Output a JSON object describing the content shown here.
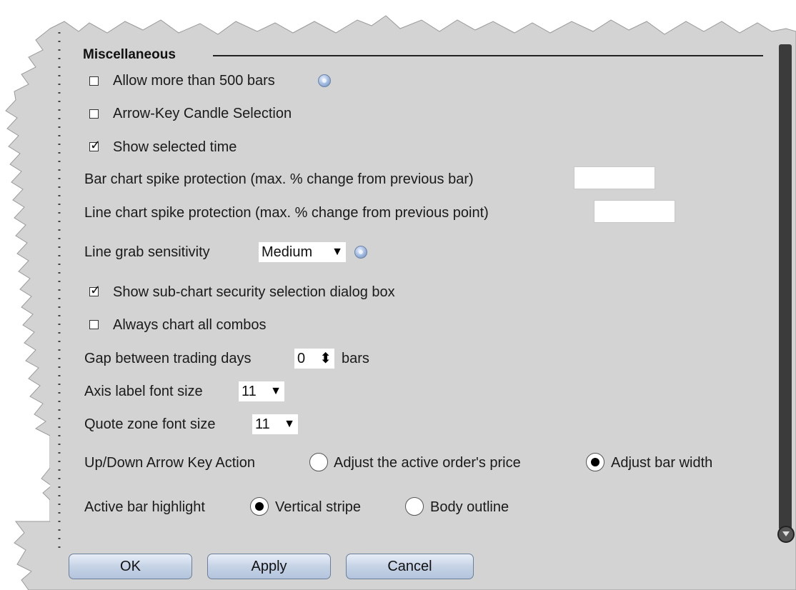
{
  "section": {
    "title": "Miscellaneous"
  },
  "options": {
    "allow_500": {
      "label": "Allow more than 500 bars",
      "checked": false
    },
    "arrow_key_candle": {
      "label": "Arrow-Key Candle Selection",
      "checked": false
    },
    "show_selected_time": {
      "label": "Show selected time",
      "checked": true
    },
    "bar_spike": {
      "label": "Bar chart spike protection (max. % change from previous bar)",
      "value": ""
    },
    "line_spike": {
      "label": "Line chart spike protection (max. % change from previous point)",
      "value": ""
    },
    "line_grab": {
      "label": "Line grab sensitivity",
      "value": "Medium"
    },
    "show_subchart": {
      "label": "Show sub-chart security selection dialog box",
      "checked": true
    },
    "always_combos": {
      "label": "Always chart all combos",
      "checked": false
    },
    "gap_days": {
      "label": "Gap between trading days",
      "value": "0",
      "unit": "bars"
    },
    "axis_font": {
      "label": "Axis label font size",
      "value": "11"
    },
    "quote_font": {
      "label": "Quote zone font size",
      "value": "11"
    },
    "updown": {
      "label": "Up/Down Arrow Key Action",
      "opt1": "Adjust the active order's price",
      "opt2": "Adjust bar width",
      "selected": "Adjust bar width"
    },
    "active_bar": {
      "label": "Active bar highlight",
      "opt1": "Vertical stripe",
      "opt2": "Body outline",
      "selected": "Vertical stripe"
    }
  },
  "glyphs": {
    "check": "✓",
    "dropdown_arrow": "▼",
    "spinner": "⬍"
  },
  "buttons": {
    "ok": "OK",
    "apply": "Apply",
    "cancel": "Cancel"
  },
  "colors": {
    "panel_bg": "#d3d3d3",
    "button_blue": "#c6d3e6"
  },
  "icons": {
    "help": "help-icon"
  }
}
